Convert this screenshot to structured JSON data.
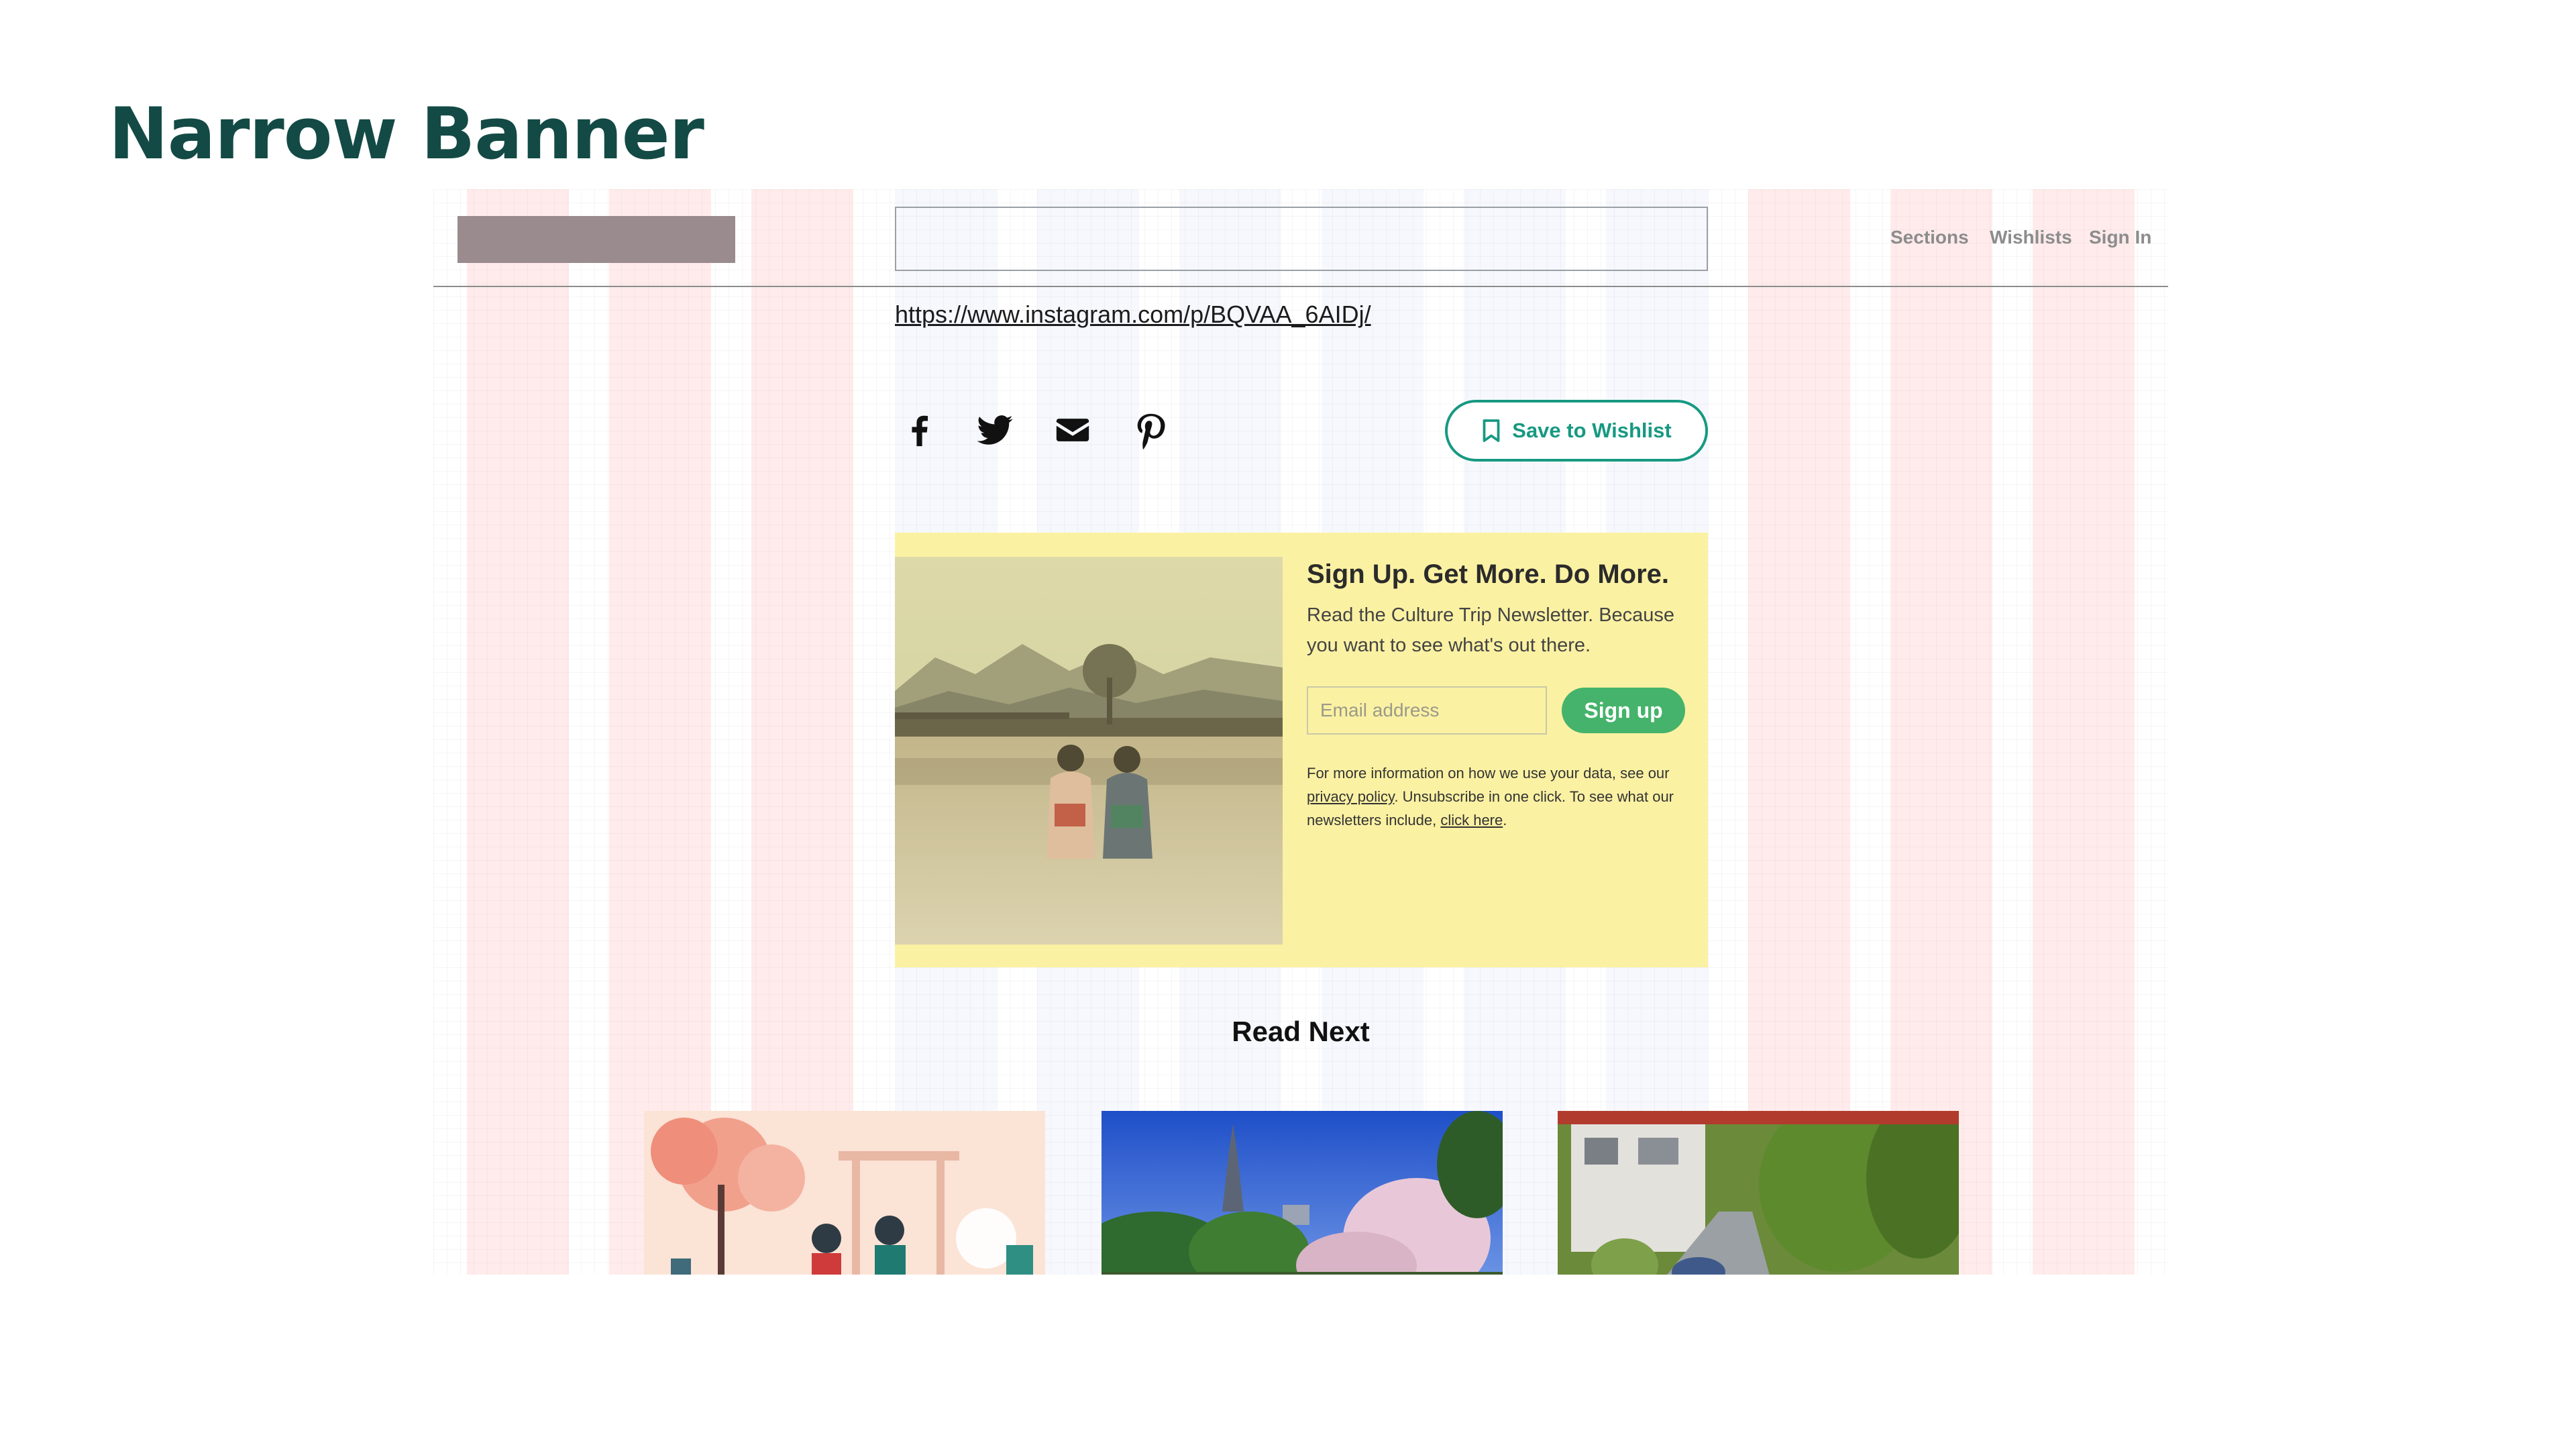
{
  "slide": {
    "title": "Narrow Banner"
  },
  "header": {
    "nav": {
      "sections": "Sections",
      "wishlists": "Wishlists",
      "sign_in": "Sign In"
    }
  },
  "article": {
    "instagram_link": "https://www.instagram.com/p/BQVAA_6AIDj/"
  },
  "share": {
    "icons": [
      "facebook-icon",
      "twitter-icon",
      "email-icon",
      "pinterest-icon"
    ],
    "wishlist_label": "Save to Wishlist"
  },
  "newsletter": {
    "heading": "Sign Up. Get More. Do More.",
    "body": "Read the Culture Trip Newsletter. Because you want to see what's out there.",
    "email_placeholder": "Email address",
    "signup_label": "Sign up",
    "fine_part1": "For more information on how we use your data, see our ",
    "privacy_link": "privacy policy",
    "fine_part2": ". Unsubscribe in one click. To see what our newsletters include, ",
    "click_here": "click here",
    "fine_part3": "."
  },
  "read_next": {
    "heading": "Read Next"
  },
  "colors": {
    "title": "#134a45",
    "accent_green": "#179982",
    "signup_green": "#45b36b",
    "newsletter_bg": "#fbf1a3"
  }
}
